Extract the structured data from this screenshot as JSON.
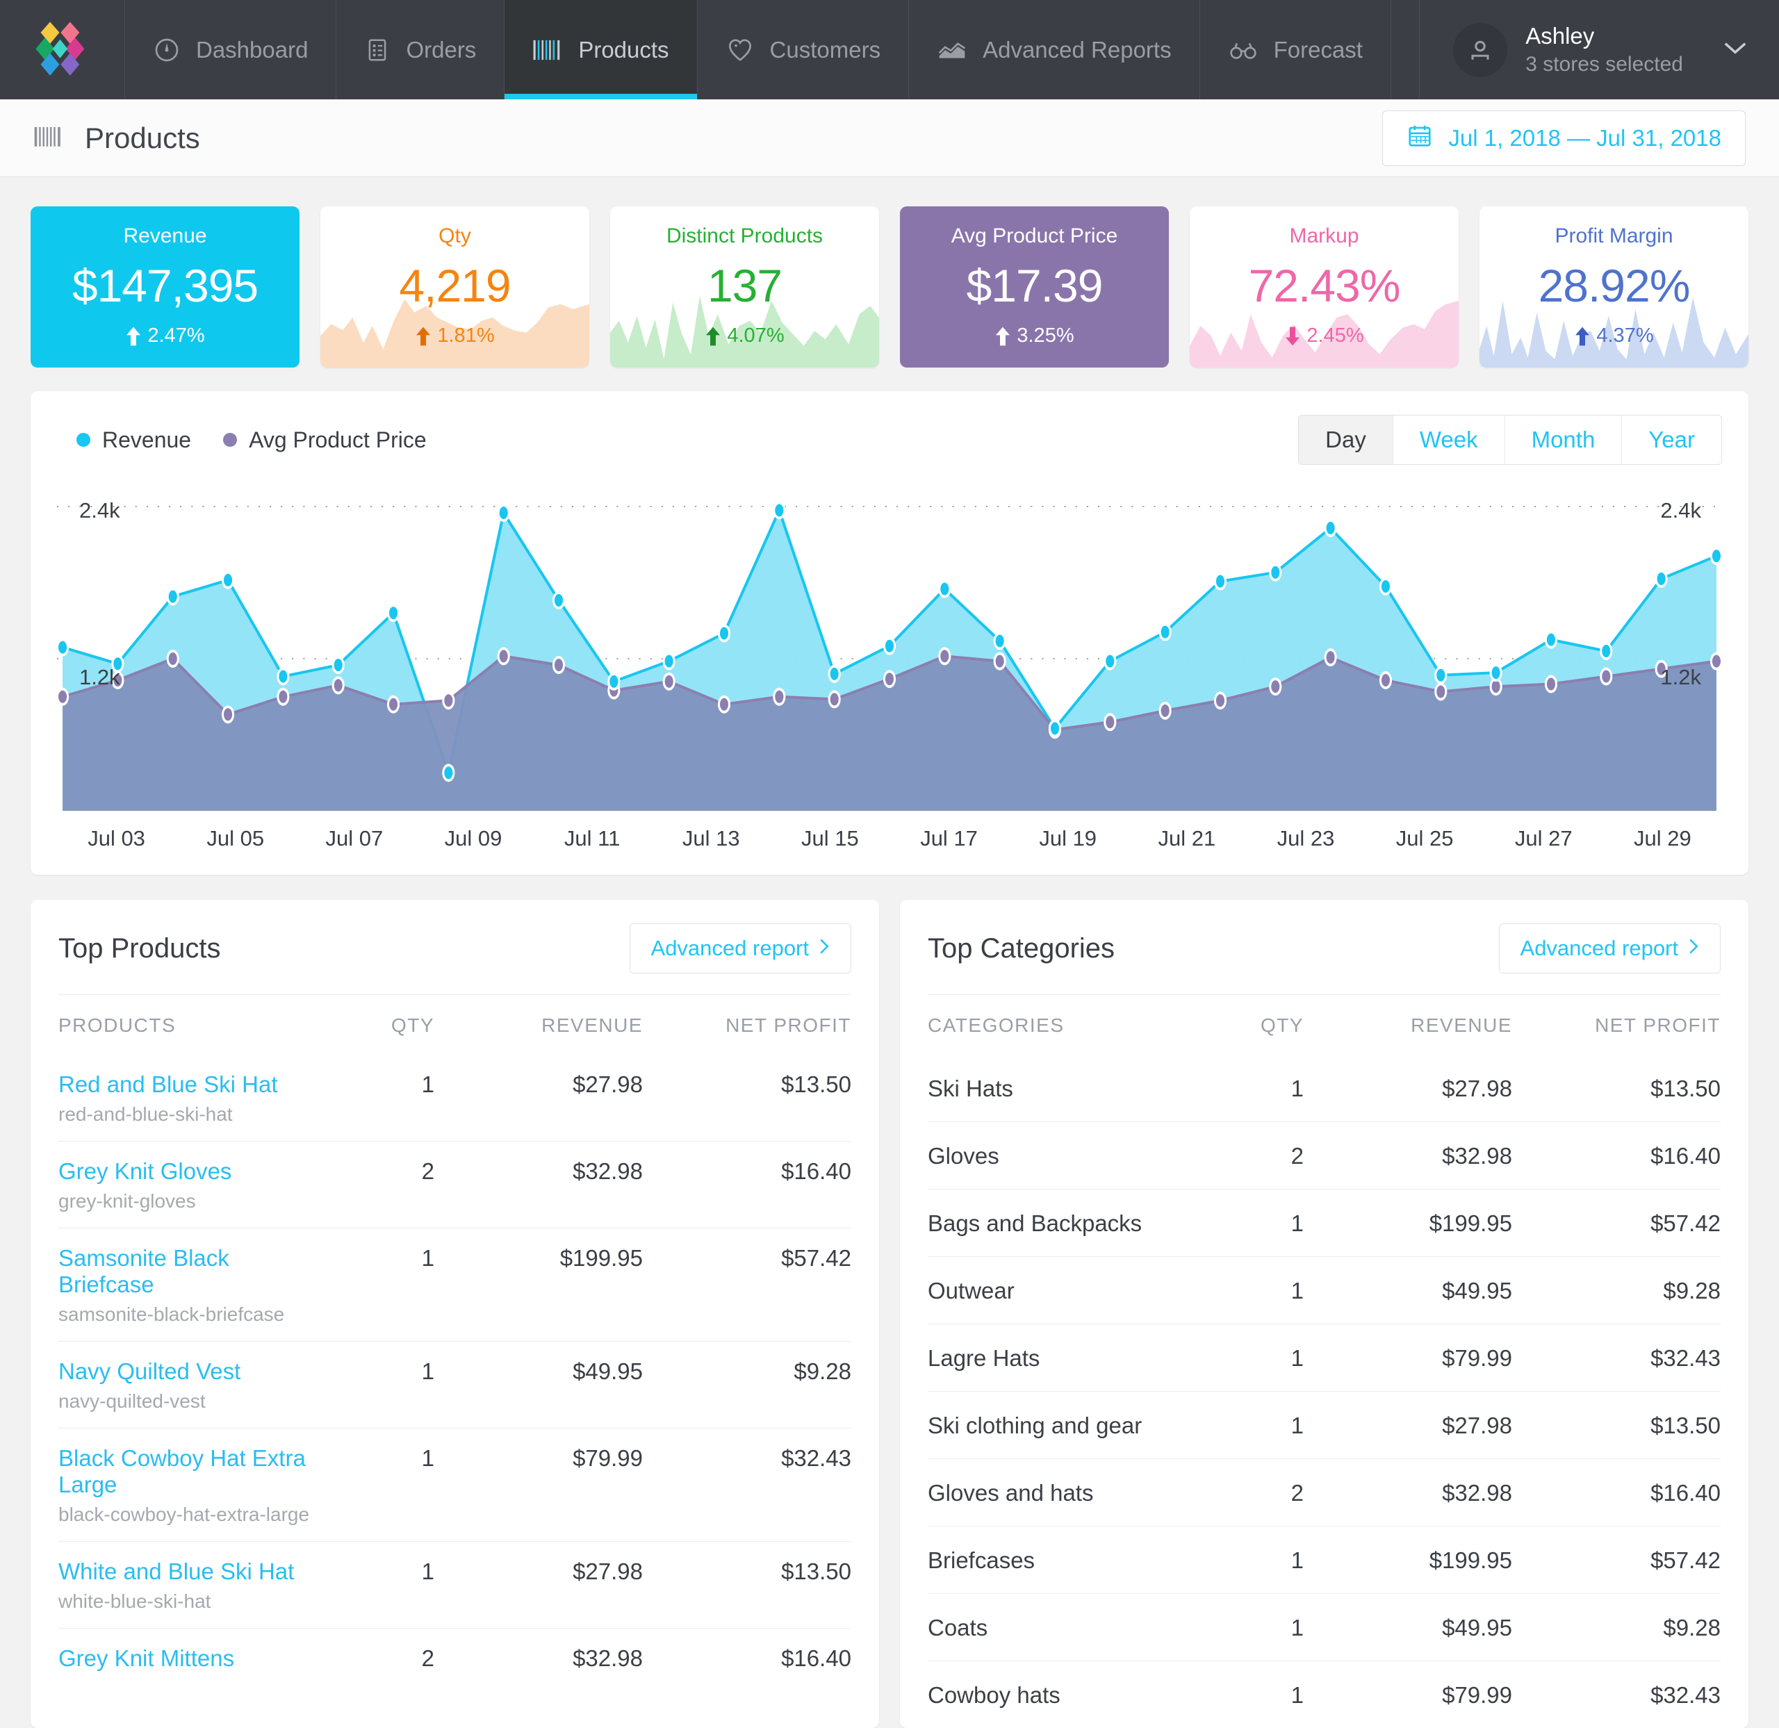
{
  "colors": {
    "brand_cyan": "#1ec7ef",
    "nav_bg": "#3b3e44",
    "revenue": "#22c8f0",
    "avg_price": "#8b7fb0",
    "qty_orange": "#f58410",
    "distinct_green": "#27b034",
    "markup_pink": "#ee67a8",
    "margin_blue": "#4f73cc",
    "purple_card": "#8a75ab"
  },
  "nav": {
    "logo_name": "logo-icon",
    "items": [
      {
        "label": "Dashboard",
        "icon": "speedometer-icon",
        "active": false
      },
      {
        "label": "Orders",
        "icon": "list-document-icon",
        "active": false
      },
      {
        "label": "Products",
        "icon": "barcode-icon",
        "active": true
      },
      {
        "label": "Customers",
        "icon": "heart-icon",
        "active": false
      },
      {
        "label": "Advanced Reports",
        "icon": "area-chart-icon",
        "active": false
      },
      {
        "label": "Forecast",
        "icon": "binoculars-icon",
        "active": false
      }
    ],
    "user": {
      "name": "Ashley",
      "subtitle": "3 stores selected",
      "avatar_icon": "person-icon",
      "chevron_icon": "chevron-down-icon"
    }
  },
  "header": {
    "title": "Products",
    "title_icon": "barcode-icon",
    "date_range": "Jul 1, 2018 — Jul 31, 2018",
    "calendar_icon": "calendar-icon"
  },
  "kpis": [
    {
      "label": "Revenue",
      "value": "$147,395",
      "delta": "2.47%",
      "direction": "up",
      "style": "filled",
      "color": "#0fc8ee",
      "spark_fill": "rgba(255,255,255,0.0)"
    },
    {
      "label": "Qty",
      "value": "4,219",
      "delta": "1.81%",
      "direction": "up",
      "style": "light",
      "color": "#f58410",
      "spark_fill": "#fbdcc0"
    },
    {
      "label": "Distinct Products",
      "value": "137",
      "delta": "4.07%",
      "direction": "up",
      "style": "light",
      "color": "#27b034",
      "spark_fill": "#c6ecca"
    },
    {
      "label": "Avg Product Price",
      "value": "$17.39",
      "delta": "3.25%",
      "direction": "up",
      "style": "filled",
      "color": "#8a75ab",
      "spark_fill": "rgba(255,255,255,0.0)"
    },
    {
      "label": "Markup",
      "value": "72.43%",
      "delta": "2.45%",
      "direction": "down",
      "style": "light",
      "color": "#ee67a8",
      "spark_fill": "#fad3e6"
    },
    {
      "label": "Profit Margin",
      "value": "28.92%",
      "delta": "4.37%",
      "direction": "up",
      "style": "light",
      "color": "#4f73cc",
      "spark_fill": "#ccd9f2"
    }
  ],
  "chart_panel": {
    "legend": [
      {
        "label": "Revenue",
        "color": "#18c6ef"
      },
      {
        "label": "Avg Product Price",
        "color": "#8b7fb0"
      }
    ],
    "periods": [
      {
        "label": "Day",
        "active": true
      },
      {
        "label": "Week",
        "active": false
      },
      {
        "label": "Month",
        "active": false
      },
      {
        "label": "Year",
        "active": false
      }
    ],
    "y_label_top": "2.4k",
    "y_label_mid": "1.2k"
  },
  "chart_data": {
    "type": "area",
    "title": "",
    "xlabel": "",
    "ylabel": "",
    "ylim": [
      0,
      2400
    ],
    "grid": true,
    "gridlines": [
      1200,
      2400
    ],
    "legend_position": "top-left",
    "x": [
      "Jul 01",
      "Jul 02",
      "Jul 03",
      "Jul 04",
      "Jul 05",
      "Jul 06",
      "Jul 07",
      "Jul 08",
      "Jul 09",
      "Jul 10",
      "Jul 11",
      "Jul 12",
      "Jul 13",
      "Jul 14",
      "Jul 15",
      "Jul 16",
      "Jul 17",
      "Jul 18",
      "Jul 19",
      "Jul 20",
      "Jul 21",
      "Jul 22",
      "Jul 23",
      "Jul 24",
      "Jul 25",
      "Jul 26",
      "Jul 27",
      "Jul 28",
      "Jul 29",
      "Jul 30",
      "Jul 31"
    ],
    "tick_labels": [
      "Jul 03",
      "Jul 05",
      "Jul 07",
      "Jul 09",
      "Jul 11",
      "Jul 13",
      "Jul 15",
      "Jul 17",
      "Jul 19",
      "Jul 21",
      "Jul 23",
      "Jul 25",
      "Jul 27",
      "Jul 29"
    ],
    "series": [
      {
        "name": "Revenue",
        "color": "#18c6ef",
        "values": [
          1290,
          1160,
          1690,
          1820,
          1060,
          1150,
          1560,
          300,
          2350,
          1660,
          1020,
          1180,
          1400,
          2370,
          1080,
          1300,
          1750,
          1340,
          650,
          1180,
          1410,
          1810,
          1880,
          2230,
          1770,
          1070,
          1090,
          1350,
          1260,
          1830,
          2010
        ]
      },
      {
        "name": "Avg Product Price",
        "color": "#8b7fb0",
        "values": [
          900,
          1030,
          1200,
          760,
          900,
          990,
          840,
          870,
          1220,
          1150,
          950,
          1020,
          840,
          900,
          880,
          1040,
          1220,
          1180,
          640,
          700,
          790,
          870,
          980,
          1210,
          1030,
          940,
          980,
          1000,
          1060,
          1120,
          1180
        ]
      }
    ]
  },
  "top_products": {
    "title": "Top Products",
    "advanced_report_label": "Advanced report",
    "columns": [
      "PRODUCTS",
      "QTY",
      "REVENUE",
      "NET PROFIT"
    ],
    "rows": [
      {
        "name": "Red and Blue Ski Hat",
        "slug": "red-and-blue-ski-hat",
        "qty": "1",
        "revenue": "$27.98",
        "net_profit": "$13.50"
      },
      {
        "name": "Grey Knit Gloves",
        "slug": "grey-knit-gloves",
        "qty": "2",
        "revenue": "$32.98",
        "net_profit": "$16.40"
      },
      {
        "name": "Samsonite Black Briefcase",
        "slug": "samsonite-black-briefcase",
        "qty": "1",
        "revenue": "$199.95",
        "net_profit": "$57.42"
      },
      {
        "name": "Navy Quilted Vest",
        "slug": "navy-quilted-vest",
        "qty": "1",
        "revenue": "$49.95",
        "net_profit": "$9.28"
      },
      {
        "name": "Black Cowboy Hat Extra Large",
        "slug": "black-cowboy-hat-extra-large",
        "qty": "1",
        "revenue": "$79.99",
        "net_profit": "$32.43"
      },
      {
        "name": "White and Blue Ski Hat",
        "slug": "white-blue-ski-hat",
        "qty": "1",
        "revenue": "$27.98",
        "net_profit": "$13.50"
      },
      {
        "name": "Grey Knit Mittens",
        "slug": "",
        "qty": "2",
        "revenue": "$32.98",
        "net_profit": "$16.40"
      }
    ]
  },
  "top_categories": {
    "title": "Top Categories",
    "advanced_report_label": "Advanced report",
    "columns": [
      "CATEGORIES",
      "QTY",
      "REVENUE",
      "NET PROFIT"
    ],
    "rows": [
      {
        "name": "Ski Hats",
        "qty": "1",
        "revenue": "$27.98",
        "net_profit": "$13.50"
      },
      {
        "name": "Gloves",
        "qty": "2",
        "revenue": "$32.98",
        "net_profit": "$16.40"
      },
      {
        "name": "Bags and Backpacks",
        "qty": "1",
        "revenue": "$199.95",
        "net_profit": "$57.42"
      },
      {
        "name": "Outwear",
        "qty": "1",
        "revenue": "$49.95",
        "net_profit": "$9.28"
      },
      {
        "name": "Lagre Hats",
        "qty": "1",
        "revenue": "$79.99",
        "net_profit": "$32.43"
      },
      {
        "name": "Ski clothing and gear",
        "qty": "1",
        "revenue": "$27.98",
        "net_profit": "$13.50"
      },
      {
        "name": "Gloves and hats",
        "qty": "2",
        "revenue": "$32.98",
        "net_profit": "$16.40"
      },
      {
        "name": "Briefcases",
        "qty": "1",
        "revenue": "$199.95",
        "net_profit": "$57.42"
      },
      {
        "name": "Coats",
        "qty": "1",
        "revenue": "$49.95",
        "net_profit": "$9.28"
      },
      {
        "name": "Cowboy hats",
        "qty": "1",
        "revenue": "$79.99",
        "net_profit": "$32.43"
      }
    ]
  }
}
